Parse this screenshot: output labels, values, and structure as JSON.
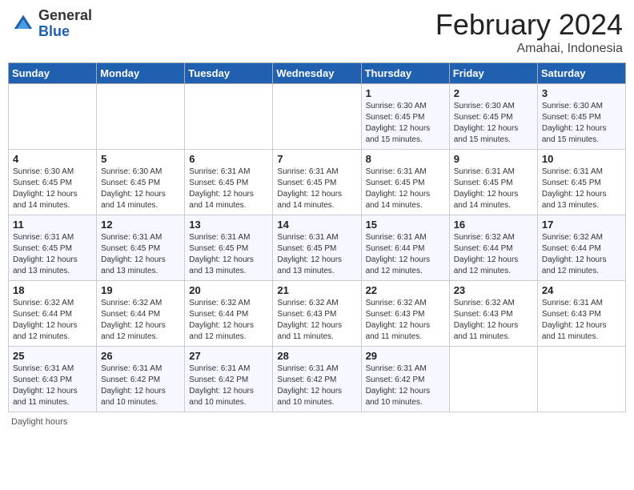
{
  "header": {
    "logo_line1": "General",
    "logo_line2": "Blue",
    "month": "February 2024",
    "location": "Amahai, Indonesia"
  },
  "weekdays": [
    "Sunday",
    "Monday",
    "Tuesday",
    "Wednesday",
    "Thursday",
    "Friday",
    "Saturday"
  ],
  "footer": {
    "daylight_label": "Daylight hours"
  },
  "weeks": [
    [
      {
        "day": "",
        "info": ""
      },
      {
        "day": "",
        "info": ""
      },
      {
        "day": "",
        "info": ""
      },
      {
        "day": "",
        "info": ""
      },
      {
        "day": "1",
        "info": "Sunrise: 6:30 AM\nSunset: 6:45 PM\nDaylight: 12 hours\nand 15 minutes."
      },
      {
        "day": "2",
        "info": "Sunrise: 6:30 AM\nSunset: 6:45 PM\nDaylight: 12 hours\nand 15 minutes."
      },
      {
        "day": "3",
        "info": "Sunrise: 6:30 AM\nSunset: 6:45 PM\nDaylight: 12 hours\nand 15 minutes."
      }
    ],
    [
      {
        "day": "4",
        "info": "Sunrise: 6:30 AM\nSunset: 6:45 PM\nDaylight: 12 hours\nand 14 minutes."
      },
      {
        "day": "5",
        "info": "Sunrise: 6:30 AM\nSunset: 6:45 PM\nDaylight: 12 hours\nand 14 minutes."
      },
      {
        "day": "6",
        "info": "Sunrise: 6:31 AM\nSunset: 6:45 PM\nDaylight: 12 hours\nand 14 minutes."
      },
      {
        "day": "7",
        "info": "Sunrise: 6:31 AM\nSunset: 6:45 PM\nDaylight: 12 hours\nand 14 minutes."
      },
      {
        "day": "8",
        "info": "Sunrise: 6:31 AM\nSunset: 6:45 PM\nDaylight: 12 hours\nand 14 minutes."
      },
      {
        "day": "9",
        "info": "Sunrise: 6:31 AM\nSunset: 6:45 PM\nDaylight: 12 hours\nand 14 minutes."
      },
      {
        "day": "10",
        "info": "Sunrise: 6:31 AM\nSunset: 6:45 PM\nDaylight: 12 hours\nand 13 minutes."
      }
    ],
    [
      {
        "day": "11",
        "info": "Sunrise: 6:31 AM\nSunset: 6:45 PM\nDaylight: 12 hours\nand 13 minutes."
      },
      {
        "day": "12",
        "info": "Sunrise: 6:31 AM\nSunset: 6:45 PM\nDaylight: 12 hours\nand 13 minutes."
      },
      {
        "day": "13",
        "info": "Sunrise: 6:31 AM\nSunset: 6:45 PM\nDaylight: 12 hours\nand 13 minutes."
      },
      {
        "day": "14",
        "info": "Sunrise: 6:31 AM\nSunset: 6:45 PM\nDaylight: 12 hours\nand 13 minutes."
      },
      {
        "day": "15",
        "info": "Sunrise: 6:31 AM\nSunset: 6:44 PM\nDaylight: 12 hours\nand 12 minutes."
      },
      {
        "day": "16",
        "info": "Sunrise: 6:32 AM\nSunset: 6:44 PM\nDaylight: 12 hours\nand 12 minutes."
      },
      {
        "day": "17",
        "info": "Sunrise: 6:32 AM\nSunset: 6:44 PM\nDaylight: 12 hours\nand 12 minutes."
      }
    ],
    [
      {
        "day": "18",
        "info": "Sunrise: 6:32 AM\nSunset: 6:44 PM\nDaylight: 12 hours\nand 12 minutes."
      },
      {
        "day": "19",
        "info": "Sunrise: 6:32 AM\nSunset: 6:44 PM\nDaylight: 12 hours\nand 12 minutes."
      },
      {
        "day": "20",
        "info": "Sunrise: 6:32 AM\nSunset: 6:44 PM\nDaylight: 12 hours\nand 12 minutes."
      },
      {
        "day": "21",
        "info": "Sunrise: 6:32 AM\nSunset: 6:43 PM\nDaylight: 12 hours\nand 11 minutes."
      },
      {
        "day": "22",
        "info": "Sunrise: 6:32 AM\nSunset: 6:43 PM\nDaylight: 12 hours\nand 11 minutes."
      },
      {
        "day": "23",
        "info": "Sunrise: 6:32 AM\nSunset: 6:43 PM\nDaylight: 12 hours\nand 11 minutes."
      },
      {
        "day": "24",
        "info": "Sunrise: 6:31 AM\nSunset: 6:43 PM\nDaylight: 12 hours\nand 11 minutes."
      }
    ],
    [
      {
        "day": "25",
        "info": "Sunrise: 6:31 AM\nSunset: 6:43 PM\nDaylight: 12 hours\nand 11 minutes."
      },
      {
        "day": "26",
        "info": "Sunrise: 6:31 AM\nSunset: 6:42 PM\nDaylight: 12 hours\nand 10 minutes."
      },
      {
        "day": "27",
        "info": "Sunrise: 6:31 AM\nSunset: 6:42 PM\nDaylight: 12 hours\nand 10 minutes."
      },
      {
        "day": "28",
        "info": "Sunrise: 6:31 AM\nSunset: 6:42 PM\nDaylight: 12 hours\nand 10 minutes."
      },
      {
        "day": "29",
        "info": "Sunrise: 6:31 AM\nSunset: 6:42 PM\nDaylight: 12 hours\nand 10 minutes."
      },
      {
        "day": "",
        "info": ""
      },
      {
        "day": "",
        "info": ""
      }
    ]
  ]
}
